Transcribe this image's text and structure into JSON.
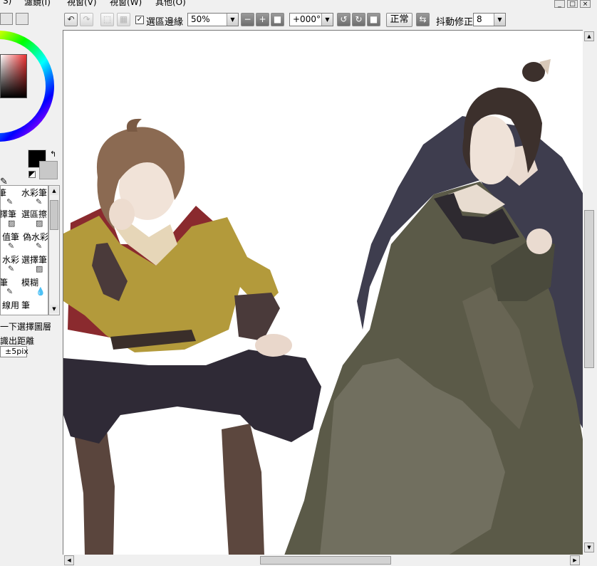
{
  "menu": [
    "濾鏡(I)",
    "視窗(V)",
    "視窗(W)",
    "其他(O)"
  ],
  "menu_left_fragment": "S)",
  "window_controls": [
    "_",
    "□",
    "×"
  ],
  "toolbar": {
    "selection_edge_label": "選區邊緣",
    "selection_edge_checked": true,
    "zoom_value": "50%",
    "rotation_value": "+000°",
    "blend_label": "正常",
    "stabilizer_label": "抖動修正",
    "stabilizer_value": "8"
  },
  "colors": {
    "foreground": "#000000",
    "background": "#c8c8c8"
  },
  "tools": [
    [
      "筆",
      "水彩筆"
    ],
    [
      "擇筆",
      "選區擦"
    ],
    [
      "值筆",
      "偽水彩"
    ],
    [
      "水彩",
      "選擇筆"
    ],
    [
      "筆",
      "模糊"
    ],
    [
      "線用",
      "筆"
    ]
  ],
  "left_panel": {
    "select_layer_label": "一下選擇圖層",
    "distance_label": "識出距離",
    "distance_value": "±5pix"
  },
  "icons": {
    "undo": "undo-icon",
    "redo": "redo-icon",
    "deselect": "deselect-icon",
    "invert": "invert-icon",
    "zoom_out": "zoom-out-icon",
    "zoom_in": "zoom-in-icon",
    "zoom_reset": "zoom-reset-icon",
    "rotate_left": "rotate-left-icon",
    "rotate_right": "rotate-right-icon",
    "rotate_reset": "rotate-reset-icon",
    "flip": "flip-icon"
  }
}
